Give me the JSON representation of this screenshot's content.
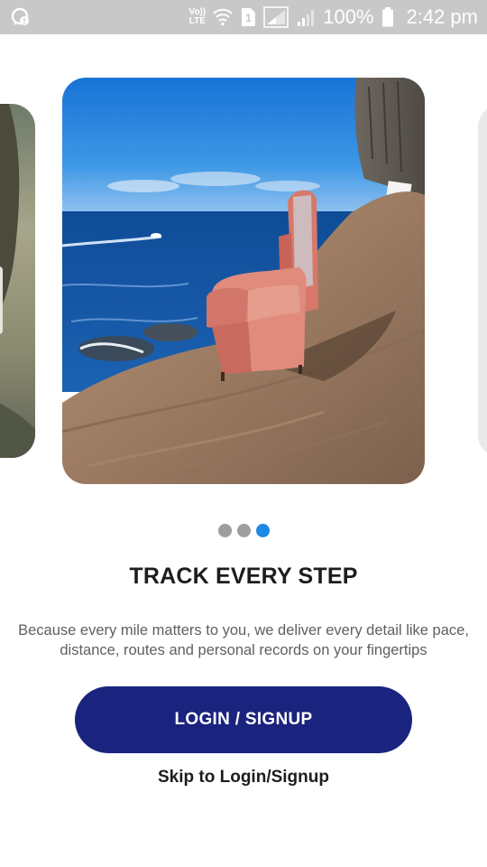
{
  "status_bar": {
    "left_icon": "whatsapp-notification-icon",
    "volte_label": "Vo)) LTE",
    "sim_label": "1",
    "battery_percent": "100%",
    "time": "2:42 pm",
    "icons": [
      "volte-icon",
      "wifi-icon",
      "sim-1-icon",
      "signal-icon",
      "signal-icon",
      "battery-icon"
    ]
  },
  "carousel": {
    "slide_count": 3,
    "active_index": 2,
    "current_image": "armchair-on-seaside-cliff-photo"
  },
  "onboarding": {
    "title": "TRACK EVERY STEP",
    "description": "Because every mile matters to you, we deliver every detail like pace, distance, routes and personal records on your fingertips"
  },
  "actions": {
    "login_label": "LOGIN / SIGNUP",
    "skip_label": "Skip to Login/Signup"
  },
  "colors": {
    "status_bar": "#c8c8c8",
    "primary_button": "#1a237e",
    "active_dot": "#1e88e5",
    "inactive_dot": "#9e9e9e"
  }
}
